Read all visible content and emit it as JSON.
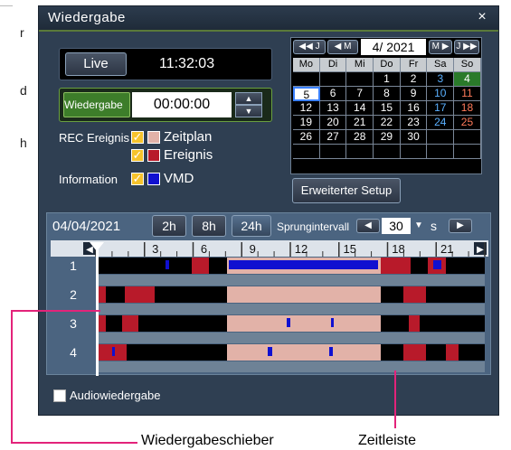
{
  "page_fragment": {
    "lines": [
      "r",
      "d",
      "h"
    ]
  },
  "window": {
    "title": "Wiedergabe",
    "close": "×"
  },
  "live": {
    "button": "Live",
    "time": "11:32:03"
  },
  "playback": {
    "button": "Wiedergabe",
    "time": "00:00:00",
    "up": "▲",
    "down": "▼"
  },
  "rec_event": {
    "label": "REC Ereignis",
    "options": [
      {
        "label": "Zeitplan",
        "checked": true,
        "color": "#e2b2a8"
      },
      {
        "label": "Ereignis",
        "checked": true,
        "color": "#b81a2a"
      }
    ]
  },
  "information": {
    "label": "Information",
    "option": {
      "label": "VMD",
      "checked": true,
      "color": "#1010d0"
    }
  },
  "calendar": {
    "nav": {
      "prev_year": "◀◀ J",
      "prev_month": "◀ M",
      "month": "4/ 2021",
      "next_month": "M ▶",
      "next_year": "J ▶▶"
    },
    "weekdays": [
      "Mo",
      "Di",
      "Mi",
      "Do",
      "Fr",
      "Sa",
      "So"
    ],
    "weeks": [
      [
        "",
        "",
        "",
        "1",
        "2",
        "3",
        "4"
      ],
      [
        "5",
        "6",
        "7",
        "8",
        "9",
        "10",
        "11"
      ],
      [
        "12",
        "13",
        "14",
        "15",
        "16",
        "17",
        "18"
      ],
      [
        "19",
        "20",
        "21",
        "22",
        "23",
        "24",
        "25"
      ],
      [
        "26",
        "27",
        "28",
        "29",
        "30",
        "",
        ""
      ],
      [
        "",
        "",
        "",
        "",
        "",
        "",
        ""
      ]
    ],
    "selected": "5",
    "recorded_green": "4",
    "colors": {
      "saturday": "#5ab0ff",
      "sunday": "#ff7a5a",
      "selected_bg": "#ffffff",
      "green_bg": "#2a7a2a"
    }
  },
  "setup_button": "Erweiterter Setup",
  "timeline": {
    "date": "04/04/2021",
    "zoom": [
      "2h",
      "8h",
      "24h"
    ],
    "active_zoom": "24h",
    "jump_label": "Sprungintervall",
    "jump_left": "◀",
    "jump_right": "▶",
    "jump_value": "30",
    "jump_dropdown": "▼",
    "jump_unit": "s",
    "scale_left": "◀",
    "scale_right": "▶",
    "hours": [
      "3",
      "6",
      "9",
      "12",
      "15",
      "18",
      "21"
    ],
    "channels": [
      "1",
      "2",
      "3",
      "4"
    ],
    "cursor_hour": 0.0,
    "colors": {
      "none": "#000000",
      "schedule": "#e2b2a8",
      "event": "#b81a2a",
      "vmd": "#1010d0"
    },
    "tracks": [
      [
        {
          "start": 0.0,
          "end": 0.8,
          "type": "none"
        },
        {
          "start": 4.3,
          "end": 4.5,
          "type": "vmd"
        },
        {
          "start": 5.9,
          "end": 7.0,
          "type": "event"
        },
        {
          "start": 8.1,
          "end": 17.6,
          "type": "schedule"
        },
        {
          "start": 8.2,
          "end": 17.4,
          "type": "vmd"
        },
        {
          "start": 17.6,
          "end": 19.4,
          "type": "event"
        },
        {
          "start": 20.5,
          "end": 21.6,
          "type": "event"
        },
        {
          "start": 20.8,
          "end": 21.3,
          "type": "vmd"
        }
      ],
      [
        {
          "start": 0.0,
          "end": 0.6,
          "type": "event"
        },
        {
          "start": 1.8,
          "end": 3.6,
          "type": "event"
        },
        {
          "start": 8.1,
          "end": 17.6,
          "type": "schedule"
        },
        {
          "start": 19.0,
          "end": 20.4,
          "type": "event"
        }
      ],
      [
        {
          "start": 0.0,
          "end": 0.6,
          "type": "event"
        },
        {
          "start": 1.6,
          "end": 2.6,
          "type": "event"
        },
        {
          "start": 8.1,
          "end": 17.6,
          "type": "schedule"
        },
        {
          "start": 11.8,
          "end": 12.0,
          "type": "vmd"
        },
        {
          "start": 14.5,
          "end": 14.7,
          "type": "vmd"
        },
        {
          "start": 19.3,
          "end": 20.0,
          "type": "event"
        }
      ],
      [
        {
          "start": 0.0,
          "end": 1.9,
          "type": "event"
        },
        {
          "start": 1.0,
          "end": 1.2,
          "type": "vmd"
        },
        {
          "start": 8.1,
          "end": 17.6,
          "type": "schedule"
        },
        {
          "start": 10.6,
          "end": 10.9,
          "type": "vmd"
        },
        {
          "start": 14.4,
          "end": 14.6,
          "type": "vmd"
        },
        {
          "start": 19.0,
          "end": 20.4,
          "type": "event"
        },
        {
          "start": 21.6,
          "end": 22.4,
          "type": "event"
        }
      ]
    ]
  },
  "audio": {
    "label": "Audiowiedergabe",
    "checked": false
  },
  "callouts": {
    "slider": "Wiedergabeschieber",
    "timeline": "Zeitleiste"
  }
}
